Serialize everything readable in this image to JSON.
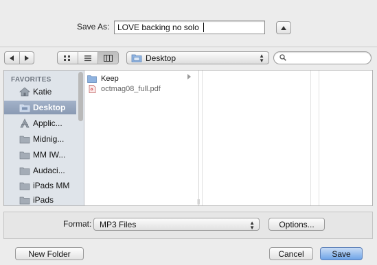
{
  "save_as": {
    "label": "Save As:",
    "filename": "LOVE backing no solo"
  },
  "toolbar": {
    "location": "Desktop",
    "location_arrows": "⌃⌄"
  },
  "sidebar": {
    "heading": "FAVORITES",
    "items": [
      {
        "label": "Katie",
        "icon": "home-icon"
      },
      {
        "label": "Desktop",
        "icon": "desktop-icon",
        "selected": true
      },
      {
        "label": "Applic...",
        "icon": "applications-icon"
      },
      {
        "label": "Midnig...",
        "icon": "folder-icon"
      },
      {
        "label": "MM IW...",
        "icon": "folder-icon"
      },
      {
        "label": "Audaci...",
        "icon": "folder-icon"
      },
      {
        "label": "iPads MM",
        "icon": "folder-icon"
      },
      {
        "label": "iPads",
        "icon": "folder-icon"
      }
    ]
  },
  "files": [
    {
      "name": "Keep",
      "icon": "folder-icon",
      "dimmed": false,
      "has_children": true
    },
    {
      "name": "octmag08_full.pdf",
      "icon": "pdf-icon",
      "dimmed": true,
      "has_children": false
    }
  ],
  "format": {
    "label": "Format:",
    "selected": "MP3 Files",
    "options_button": "Options..."
  },
  "buttons": {
    "new_folder": "New Folder",
    "cancel": "Cancel",
    "save": "Save"
  },
  "colors": {
    "accent": "#6ea4e8",
    "sidebar_bg": "#dfe4ea",
    "sidebar_selected": "#8a9ab3",
    "folder": "#8fb3e0"
  }
}
